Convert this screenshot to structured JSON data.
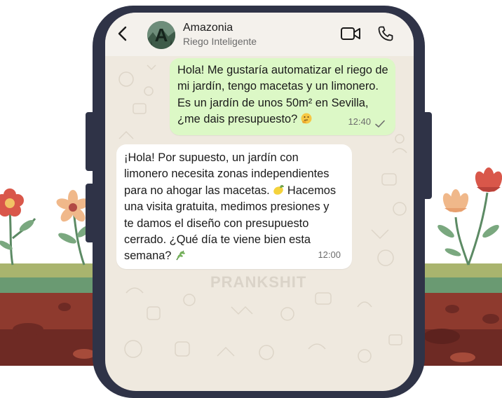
{
  "contact": {
    "name": "Amazonia",
    "status": "Riego Inteligente",
    "avatar_letter": "A"
  },
  "messages": [
    {
      "direction": "outgoing",
      "text": "Hola! Me gustaría automatizar el riego de\nmi jardín, tengo macetas y un limonero.\nEs un jardín de unos 50m² en Sevilla,\n¿me dais presupuesto?",
      "emoji": "thinking-face",
      "time": "12:40",
      "status": "sent"
    },
    {
      "direction": "incoming",
      "text_lines": [
        "¡Hola! Por supuesto, un jardín con",
        "limonero necesita zonas independientes",
        "para no ahogar las macetas.",
        "una visita gratuita, medimos presiones y",
        "te damos el diseño con presupuesto",
        "cerrado. ¿Qué día te viene bien esta",
        "semana?"
      ],
      "line3_after": "Hacemos",
      "emojis": [
        "lemon",
        "herb"
      ],
      "time": "12:00"
    }
  ],
  "watermark": "PRANKSHIT",
  "icons": {
    "back": "chevron-left-icon",
    "video": "video-camera-icon",
    "call": "phone-icon",
    "check": "check-icon"
  },
  "colors": {
    "phone_frame": "#2f3347",
    "screen_bg": "#efe9df",
    "outgoing_bubble": "#dcf8c6",
    "incoming_bubble": "#ffffff",
    "soil": "#8e3a2e",
    "grass": "#a9b46e",
    "flower_red": "#d9574a",
    "flower_peach": "#f0b88a"
  }
}
